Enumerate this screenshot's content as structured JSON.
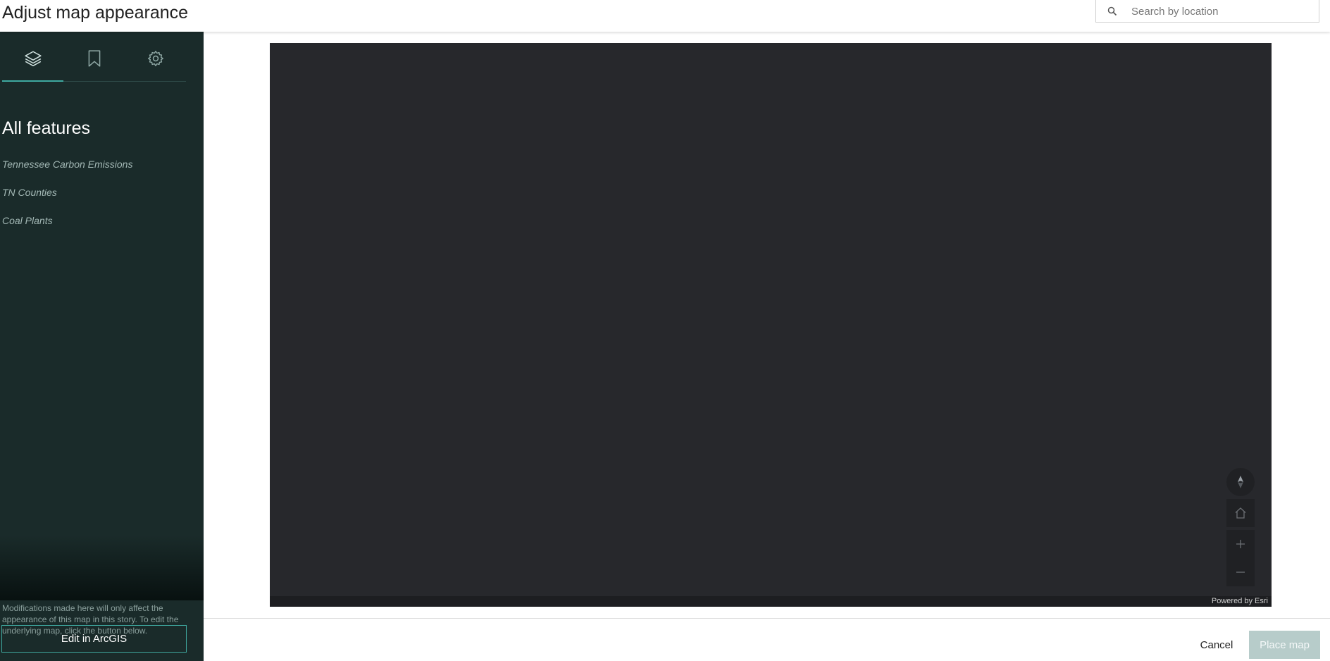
{
  "header": {
    "title": "Adjust map appearance",
    "search": {
      "placeholder": "Search by location",
      "value": ""
    }
  },
  "sidebar": {
    "tabs": [
      {
        "icon": "layers-icon",
        "active": true
      },
      {
        "icon": "bookmark-icon",
        "active": false
      },
      {
        "icon": "gear-icon",
        "active": false
      }
    ],
    "heading": "All features",
    "layers": [
      "Tennessee Carbon Emissions",
      "TN Counties",
      "Coal Plants"
    ],
    "note": "Modifications made here will only affect the appearance of this map in this story. To edit the underlying map, click the button below.",
    "edit_label": "Edit in ArcGIS"
  },
  "map": {
    "attribution": "Powered by Esri",
    "controls": [
      "compass-icon",
      "home-icon",
      "zoom-in-icon",
      "zoom-out-icon"
    ]
  },
  "footer": {
    "cancel_label": "Cancel",
    "place_label": "Place map"
  },
  "colors": {
    "sidebar": "#1a2b2a",
    "accent": "#3fa9a0",
    "map_background": "#27282c",
    "place_button": "#b7ccca"
  }
}
